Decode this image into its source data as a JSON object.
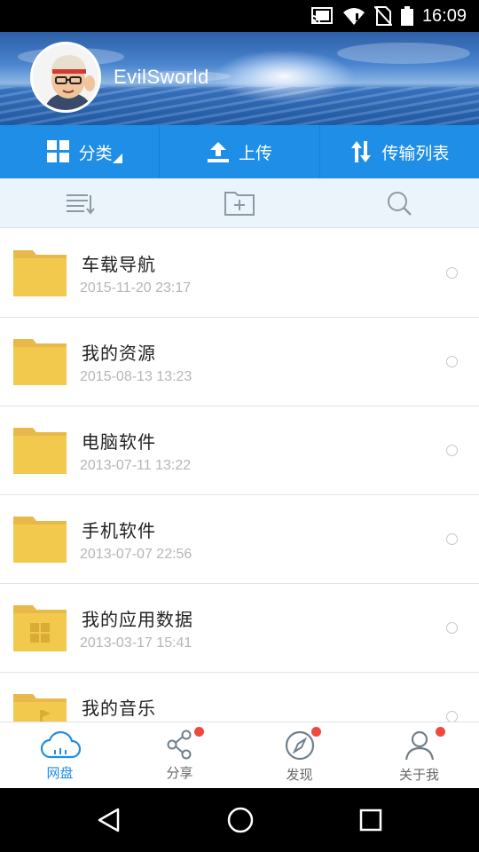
{
  "status_bar": {
    "time": "16:09",
    "icons": [
      "cast-icon",
      "wifi-icon",
      "no-sim-icon",
      "battery-icon"
    ]
  },
  "header": {
    "username": "EvilSworld",
    "avatar": "user-avatar"
  },
  "toolbar": {
    "category_label": "分类",
    "upload_label": "上传",
    "transfer_label": "传输列表"
  },
  "subbar": {
    "icons": [
      "sort-list-icon",
      "new-folder-icon",
      "search-icon"
    ]
  },
  "files": [
    {
      "name": "车载导航",
      "date": "2015-11-20   23:17",
      "icon": "folder-icon"
    },
    {
      "name": "我的资源",
      "date": "2015-08-13   13:23",
      "icon": "folder-icon"
    },
    {
      "name": "电脑软件",
      "date": "2013-07-11   13:22",
      "icon": "folder-icon"
    },
    {
      "name": "手机软件",
      "date": "2013-07-07   22:56",
      "icon": "folder-icon"
    },
    {
      "name": "我的应用数据",
      "date": "2013-03-17   15:41",
      "icon": "app-data-folder-icon"
    },
    {
      "name": "我的音乐",
      "date": "",
      "icon": "music-folder-icon"
    }
  ],
  "bottom_nav": [
    {
      "label": "网盘",
      "icon": "cloud-icon",
      "active": true,
      "badge": false
    },
    {
      "label": "分享",
      "icon": "share-icon",
      "active": false,
      "badge": true
    },
    {
      "label": "发现",
      "icon": "compass-icon",
      "active": false,
      "badge": true
    },
    {
      "label": "关于我",
      "icon": "profile-icon",
      "active": false,
      "badge": true
    }
  ],
  "colors": {
    "accent": "#1e8ee6",
    "folder": "#f2c94c",
    "badge": "#f0483e"
  }
}
